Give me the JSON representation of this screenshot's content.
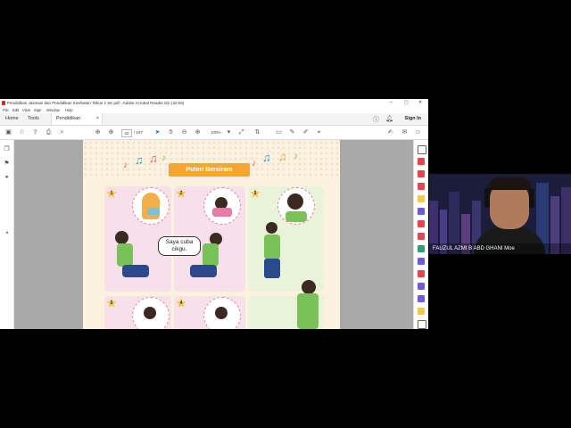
{
  "window": {
    "title": "Pendidikan Jasmani dan Pendidikan Kesihatan Tahun 1 SK.pdf - Adobe Acrobat Reader DC (32-bit)",
    "controls": [
      "–",
      "▢",
      "✕"
    ]
  },
  "menu": [
    "File",
    "Edit",
    "View",
    "Sign",
    "Window",
    "Help"
  ],
  "tabs": {
    "home": "Home",
    "tools": "Tools",
    "document": "Pendidikan Jasmani...",
    "sign_in": "Sign In"
  },
  "toolbar": {
    "page_current": "32",
    "page_total": "/ 167",
    "zoom": "100%"
  },
  "page": {
    "banner": "Puteri Bersiram",
    "speech_bubble": "Saya cuba cikgu.",
    "steps": [
      "1",
      "2",
      "3",
      "5",
      "4"
    ]
  },
  "webcam": {
    "name": "FAUZUL AZMI B ABD GHANI Moe"
  },
  "colors": {
    "banner": "#f7a531",
    "page_background": "#fbf1df",
    "panel_pink": "#f7e0ea",
    "viewer_gray": "#a9a9a9"
  }
}
